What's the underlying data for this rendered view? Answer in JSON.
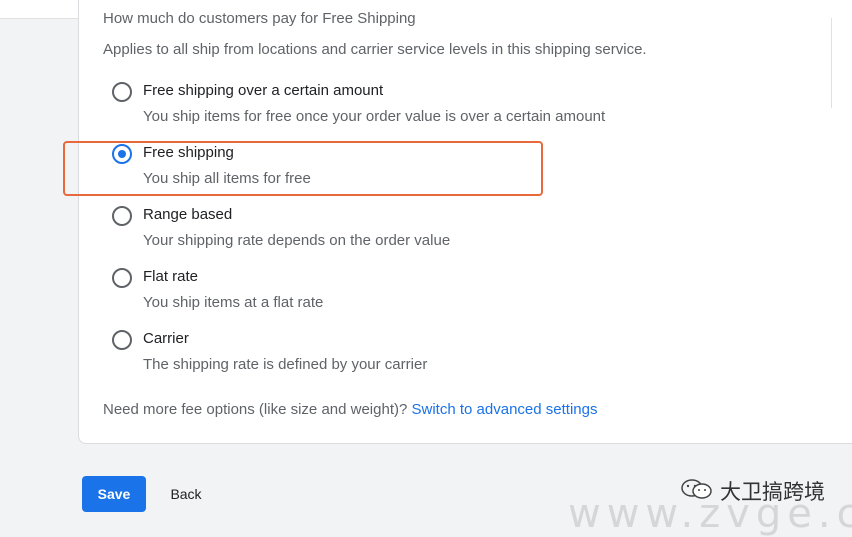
{
  "section": {
    "question": "How much do customers pay for Free Shipping",
    "helper": "Applies to all ship from locations and carrier service levels in this shipping service."
  },
  "options": [
    {
      "label": "Free shipping over a certain amount",
      "description": "You ship items for free once your order value is over a certain amount",
      "selected": false
    },
    {
      "label": "Free shipping",
      "description": "You ship all items for free",
      "selected": true
    },
    {
      "label": "Range based",
      "description": "Your shipping rate depends on the order value",
      "selected": false
    },
    {
      "label": "Flat rate",
      "description": "You ship items at a flat rate",
      "selected": false
    },
    {
      "label": "Carrier",
      "description": "The shipping rate is defined by your carrier",
      "selected": false
    }
  ],
  "more_fees": {
    "text": "Need more fee options (like size and weight)?",
    "link": "Switch to advanced settings"
  },
  "actions": {
    "save": "Save",
    "back": "Back"
  },
  "watermark": {
    "text": "大卫搞跨境",
    "url": "www.zvge.cn"
  },
  "colors": {
    "accent": "#1a73e8",
    "highlight": "#e8693c"
  }
}
